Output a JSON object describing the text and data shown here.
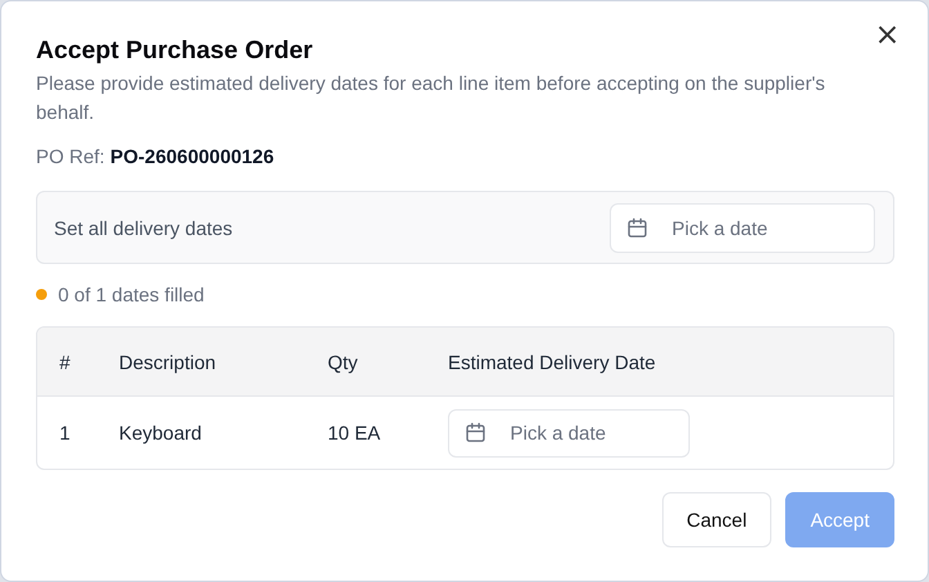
{
  "dialog": {
    "title": "Accept Purchase Order",
    "description": "Please provide estimated delivery dates for each line item before accepting on the supplier's behalf.",
    "close_icon": "×",
    "po_ref_label": "PO Ref:",
    "po_ref_value": "PO-260600000126"
  },
  "set_all": {
    "label": "Set all delivery dates",
    "date_field": {
      "placeholder": "Pick a date"
    }
  },
  "progress": {
    "text": "0 of 1 dates filled",
    "complete": false
  },
  "table": {
    "columns": [
      "#",
      "Description",
      "Qty",
      "Estimated Delivery Date"
    ],
    "rows": [
      {
        "number": "1",
        "description": "Keyboard",
        "qty": "10 EA",
        "date_field": {
          "placeholder": "Pick a date"
        }
      }
    ]
  },
  "buttons": [
    {
      "label": "Cancel",
      "kind": "secondary",
      "disabled": false
    },
    {
      "label": "Accept",
      "kind": "primary",
      "disabled": true
    }
  ]
}
